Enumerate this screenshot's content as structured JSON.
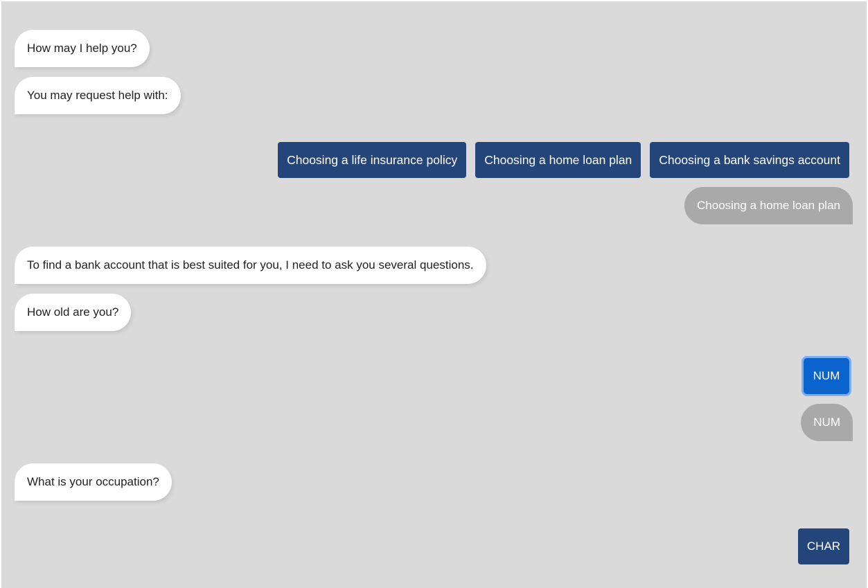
{
  "messages": {
    "greeting": "How may I help you?",
    "request_help": "You may request help with:",
    "find_account": "To find a bank account that is best suited for you, I need to ask you several questions.",
    "age_question": "How old are you?",
    "occupation_question": "What is your occupation?"
  },
  "options": [
    {
      "label": "Choosing a life insurance policy"
    },
    {
      "label": "Choosing a home loan plan"
    },
    {
      "label": "Choosing a bank savings account"
    }
  ],
  "user_replies": {
    "choice": "Choosing a home loan plan",
    "age": "NUM"
  },
  "input_buttons": {
    "num_label": "NUM",
    "char_label": "CHAR"
  },
  "colors": {
    "background": "#dadada",
    "bot_bubble": "#ffffff",
    "user_bubble": "#a9a9a9",
    "option_button": "#234579",
    "active_button": "#0b63ce"
  }
}
